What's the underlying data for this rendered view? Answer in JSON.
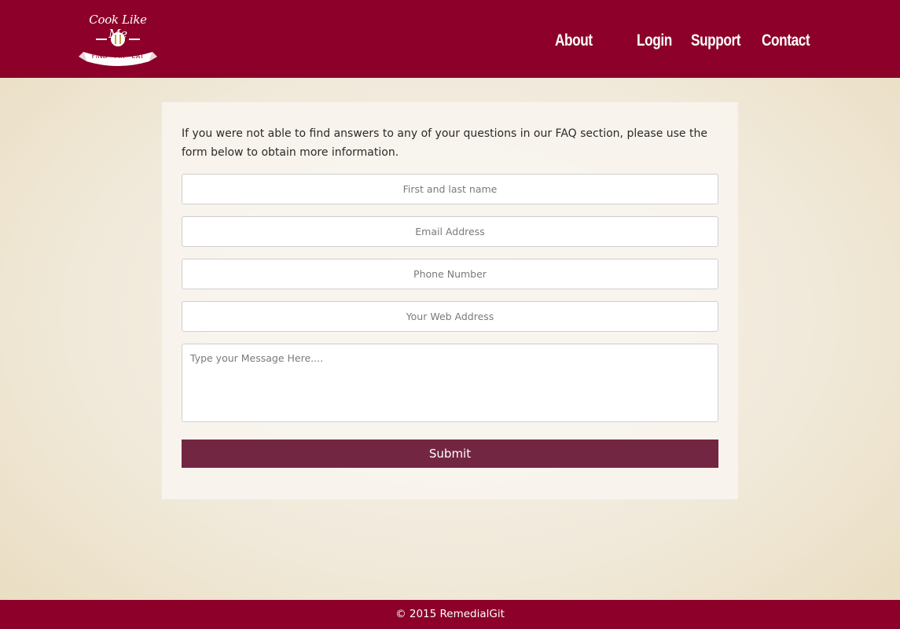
{
  "brand": {
    "name": "Cook Like Me",
    "tagline": "FIND · FIX · EAT",
    "logo_icon": "fork-knife-icon"
  },
  "nav": {
    "about": "About",
    "login": "Login",
    "support": "Support",
    "contact": "Contact"
  },
  "form": {
    "intro": "If you were not able to find answers to any of your questions in our FAQ section, please use the form below to obtain more information.",
    "name_placeholder": "First and last name",
    "email_placeholder": "Email Address",
    "phone_placeholder": "Phone Number",
    "web_placeholder": "Your Web Address",
    "message_placeholder": "Type your Message Here....",
    "submit_label": "Submit"
  },
  "footer": {
    "copyright": "© 2015 RemedialGit"
  },
  "colors": {
    "brand": "#8c0029",
    "submit": "#732642",
    "background": "#f1eadb"
  }
}
